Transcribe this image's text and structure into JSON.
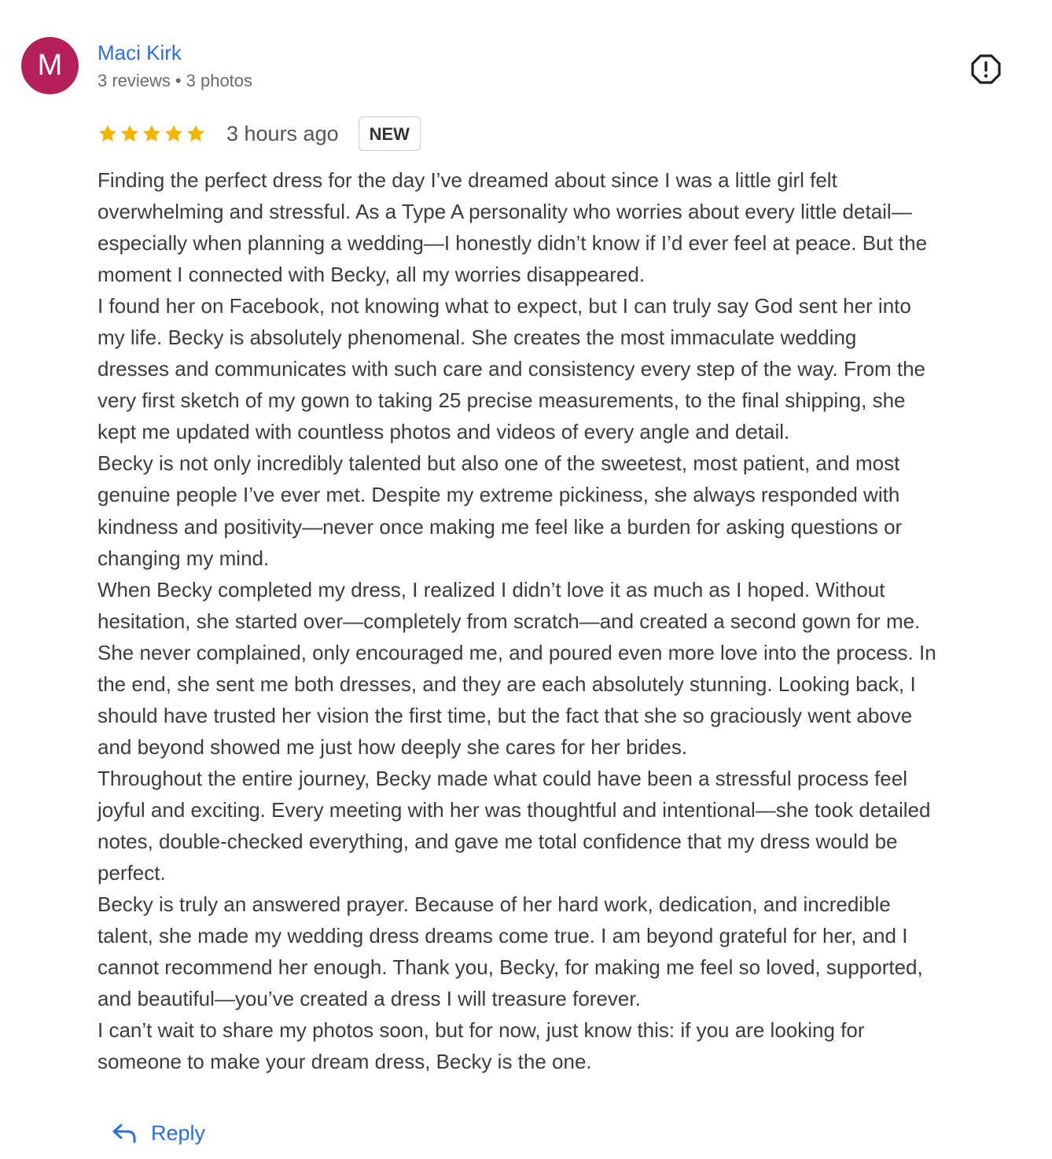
{
  "reviewer": {
    "avatar_initial": "M",
    "avatar_color": "#b5205a",
    "name": "Maci Kirk",
    "reviews_count": "3 reviews",
    "separator": "•",
    "photos_count": "3 photos"
  },
  "report_icon": "report-flag-icon",
  "rating": {
    "stars": 5,
    "max_stars": 5,
    "star_color": "#f4b400"
  },
  "timestamp": "3 hours ago",
  "badge": "NEW",
  "review_lines": [
    "Finding the perfect dress for the day I’ve dreamed about since I was a little girl felt",
    "overwhelming and stressful. As a Type A personality who worries about every little detail—",
    "especially when planning a wedding—I honestly didn’t know if I’d ever feel at peace. But the",
    "moment I connected with Becky, all my worries disappeared.",
    "I found her on Facebook, not knowing what to expect, but I can truly say God sent her into",
    "my life. Becky is absolutely phenomenal. She creates the most immaculate wedding",
    "dresses and communicates with such care and consistency every step of the way. From the",
    "very first sketch of my gown to taking 25 precise measurements, to the final shipping, she",
    "kept me updated with countless photos and videos of every angle and detail.",
    "Becky is not only incredibly talented but also one of the sweetest, most patient, and most",
    "genuine people I’ve ever met. Despite my extreme pickiness, she always responded with",
    "kindness and positivity—never once making me feel like a burden for asking questions or",
    "changing my mind.",
    "When Becky completed my dress, I realized I didn’t love it as much as I hoped. Without",
    "hesitation, she started over—completely from scratch—and created a second gown for me.",
    "She never complained, only encouraged me, and poured even more love into the process. In",
    "the end, she sent me both dresses, and they are each absolutely stunning. Looking back, I",
    "should have trusted her vision the first time, but the fact that she so graciously went above",
    "and beyond showed me just how deeply she cares for her brides.",
    "Throughout the entire journey, Becky made what could have been a stressful process feel",
    "joyful and exciting. Every meeting with her was thoughtful and intentional—she took detailed",
    "notes, double-checked everything, and gave me total confidence that my dress would be",
    "perfect.",
    "Becky is truly an answered prayer. Because of her hard work, dedication, and incredible",
    "talent, she made my wedding dress dreams come true. I am beyond grateful for her, and I",
    "cannot recommend her enough. Thank you, Becky, for making me feel so loved, supported,",
    "and beautiful—you’ve created a dress I will treasure forever.",
    "I can’t wait to share my photos soon, but for now, just know this: if you are looking for",
    "someone to make your dream dress, Becky is the one."
  ],
  "reply": {
    "label": "Reply",
    "icon": "reply-arrow-icon",
    "color": "#2a6fdb"
  }
}
